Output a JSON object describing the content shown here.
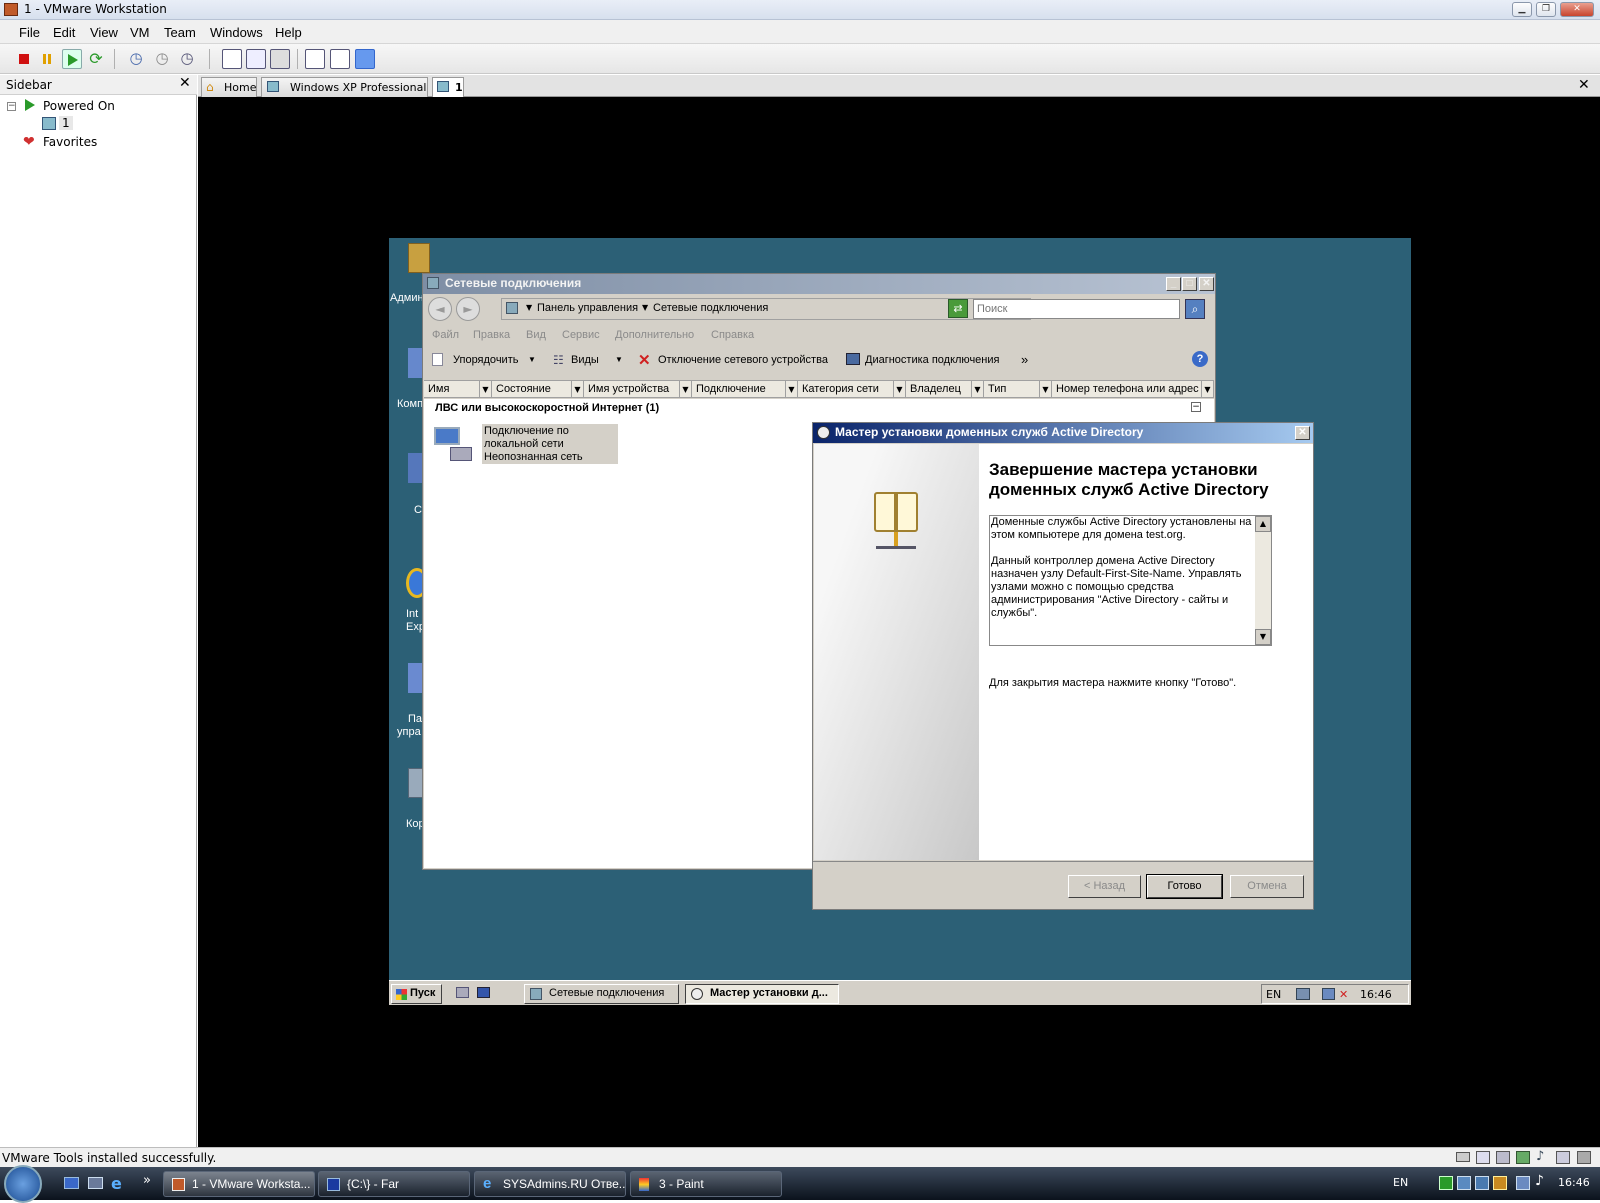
{
  "window": {
    "title": "1 - VMware Workstation"
  },
  "menu": [
    "File",
    "Edit",
    "View",
    "VM",
    "Team",
    "Windows",
    "Help"
  ],
  "sidebar": {
    "title": "Sidebar",
    "powered_on": "Powered On",
    "vm_item": "1",
    "favorites": "Favorites"
  },
  "tabs": [
    {
      "label": "Home"
    },
    {
      "label": "Windows XP Professional"
    },
    {
      "label": "1"
    }
  ],
  "desktop_labels": [
    "Админ",
    "Комп",
    "С",
    "Int",
    "Exp",
    "Па",
    "упра",
    "Кор"
  ],
  "network_window": {
    "title": "Сетевые подключения",
    "breadcrumb_1": "Панель управления",
    "breadcrumb_2": "Сетевые подключения",
    "search_placeholder": "Поиск",
    "menu": [
      "Файл",
      "Правка",
      "Вид",
      "Сервис",
      "Дополнительно",
      "Справка"
    ],
    "cmd_organize": "Упорядочить",
    "cmd_views": "Виды",
    "cmd_disable": "Отключение сетевого устройства",
    "cmd_diag": "Диагностика подключения",
    "cmd_more": "»",
    "columns": [
      "Имя",
      "Состояние",
      "Имя устройства",
      "Подключение",
      "Категория сети",
      "Владелец",
      "Тип",
      "Номер телефона или адрес узла"
    ],
    "group_title": "ЛВС или высокоскоростной Интернет (1)",
    "item_line1": "Подключение по",
    "item_line2": "локальной сети",
    "item_line3": "Неопознанная сеть"
  },
  "wizard": {
    "title": "Мастер установки доменных служб Active Directory",
    "heading_line1": "Завершение мастера установки",
    "heading_line2": "доменных служб Active Directory",
    "para1_line1": "Доменные службы Active Directory установлены на",
    "para1_line2": "этом компьютере для домена test.org.",
    "para2_line1": "Данный контроллер домена Active Directory",
    "para2_line2": "назначен узлу Default-First-Site-Name. Управлять",
    "para2_line3": "узлами можно с помощью средства",
    "para2_line4": "администрирования \"Active Directory - сайты и",
    "para2_line5": "службы\".",
    "close_hint": "Для закрытия мастера нажмите кнопку \"Готово\".",
    "back_button": "< Назад",
    "finish_button": "Готово",
    "cancel_button": "Отмена"
  },
  "guest_taskbar": {
    "start": "Пуск",
    "task1": "Сетевые подключения",
    "task2": "Мастер установки д...",
    "lang": "EN",
    "time": "16:46"
  },
  "status": {
    "text": "VMware Tools installed successfully."
  },
  "host_taskbar": {
    "tasks": [
      "1 - VMware Worksta...",
      "{C:\\} - Far",
      "SYSAdmins.RU Отве...",
      "3 - Paint"
    ],
    "more": "»",
    "lang": "EN",
    "time": "16:46"
  }
}
